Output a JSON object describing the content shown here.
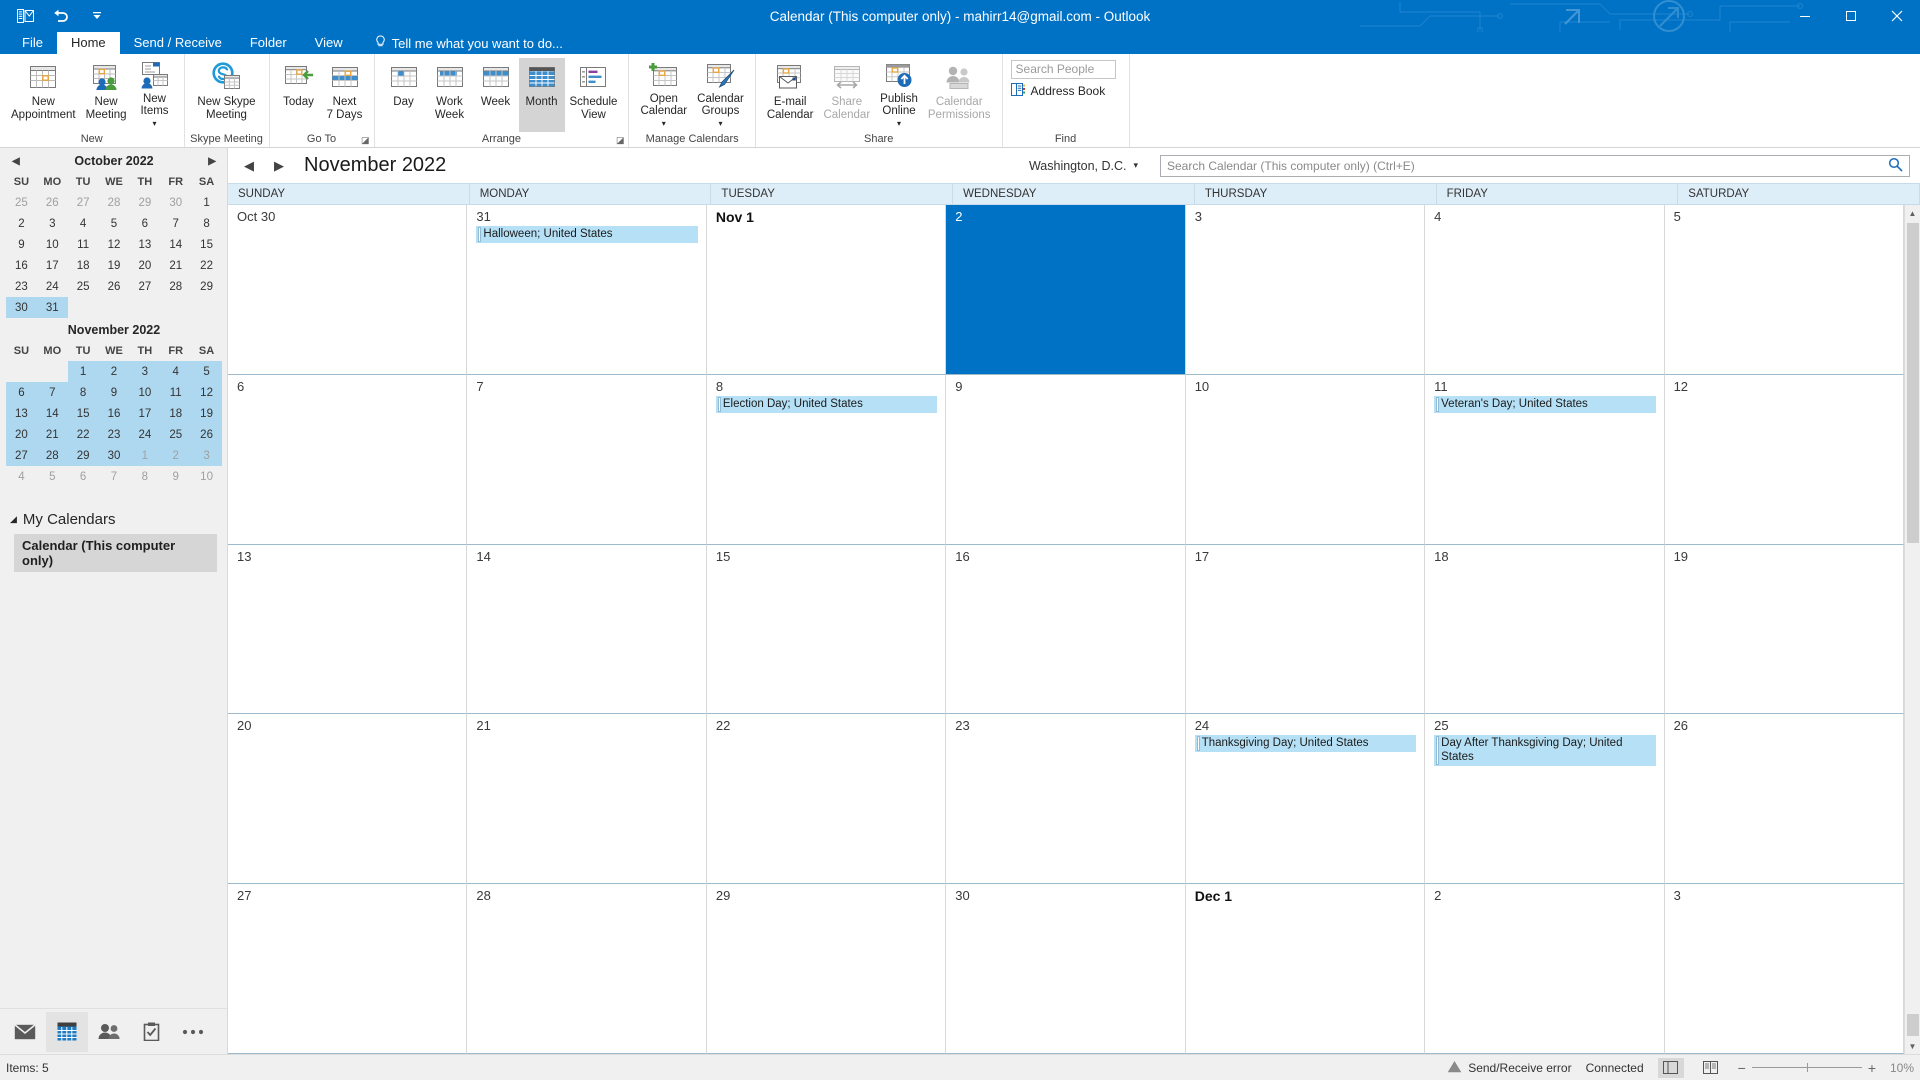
{
  "window": {
    "title": "Calendar (This computer only) - mahirr14@gmail.com - Outlook",
    "minimize": "–",
    "maximize": "□",
    "close": "✕"
  },
  "quick_access": [
    {
      "name": "send-receive-all-folders",
      "icon": "envelope-grid-icon"
    },
    {
      "name": "undo",
      "icon": "undo-arrow-icon"
    },
    {
      "name": "customize-quick-access-toolbar",
      "icon": "chevron-down-icon"
    }
  ],
  "tabs": [
    {
      "label": "File",
      "active": false
    },
    {
      "label": "Home",
      "active": true
    },
    {
      "label": "Send / Receive",
      "active": false
    },
    {
      "label": "Folder",
      "active": false
    },
    {
      "label": "View",
      "active": false
    }
  ],
  "tell_me": "Tell me what you want to do...",
  "ribbon": {
    "groups": [
      {
        "name": "New",
        "label": "New",
        "buttons": [
          {
            "label": "New\nAppointment",
            "icon": "calendar-new-icon",
            "state": "normal"
          },
          {
            "label": "New\nMeeting",
            "icon": "calendar-people-icon",
            "state": "normal",
            "dropdown": false
          },
          {
            "label": "New\nItems",
            "icon": "new-items-icon",
            "state": "normal",
            "dropdown": true
          }
        ]
      },
      {
        "name": "Skype Meeting",
        "label": "Skype Meeting",
        "buttons": [
          {
            "label": "New Skype\nMeeting",
            "icon": "skype-icon",
            "state": "normal"
          }
        ]
      },
      {
        "name": "Go To",
        "label": "Go To",
        "buttons": [
          {
            "label": "Today",
            "icon": "today-icon",
            "state": "normal"
          },
          {
            "label": "Next\n7 Days",
            "icon": "next-7-days-icon",
            "state": "normal"
          }
        ]
      },
      {
        "name": "Arrange",
        "label": "Arrange",
        "buttons": [
          {
            "label": "Day",
            "icon": "day-view-icon",
            "state": "normal"
          },
          {
            "label": "Work\nWeek",
            "icon": "work-week-icon",
            "state": "normal"
          },
          {
            "label": "Week",
            "icon": "week-view-icon",
            "state": "normal"
          },
          {
            "label": "Month",
            "icon": "month-view-icon",
            "state": "selected"
          },
          {
            "label": "Schedule\nView",
            "icon": "schedule-view-icon",
            "state": "normal"
          }
        ]
      },
      {
        "name": "Manage Calendars",
        "label": "Manage Calendars",
        "buttons": [
          {
            "label": "Open\nCalendar",
            "icon": "open-calendar-icon",
            "state": "normal",
            "dropdown": true
          },
          {
            "label": "Calendar\nGroups",
            "icon": "calendar-groups-icon",
            "state": "normal",
            "dropdown": true
          }
        ]
      },
      {
        "name": "Share",
        "label": "Share",
        "buttons": [
          {
            "label": "E-mail\nCalendar",
            "icon": "email-calendar-icon",
            "state": "normal"
          },
          {
            "label": "Share\nCalendar",
            "icon": "share-calendar-icon",
            "state": "disabled"
          },
          {
            "label": "Publish\nOnline",
            "icon": "publish-online-icon",
            "state": "normal",
            "dropdown": true
          },
          {
            "label": "Calendar\nPermissions",
            "icon": "calendar-permissions-icon",
            "state": "disabled"
          }
        ]
      }
    ],
    "find": {
      "label": "Find",
      "search_people_placeholder": "Search People",
      "address_book_label": "Address Book"
    }
  },
  "sidebar": {
    "mini_calendars": [
      {
        "title": "October 2022",
        "dow": [
          "SU",
          "MO",
          "TU",
          "WE",
          "TH",
          "FR",
          "SA"
        ],
        "weeks": [
          [
            {
              "d": "25",
              "t": "out"
            },
            {
              "d": "26",
              "t": "out"
            },
            {
              "d": "27",
              "t": "out"
            },
            {
              "d": "28",
              "t": "out"
            },
            {
              "d": "29",
              "t": "out"
            },
            {
              "d": "30",
              "t": "out"
            },
            {
              "d": "1",
              "t": "in"
            }
          ],
          [
            {
              "d": "2",
              "t": "in"
            },
            {
              "d": "3",
              "t": "in"
            },
            {
              "d": "4",
              "t": "in"
            },
            {
              "d": "5",
              "t": "in"
            },
            {
              "d": "6",
              "t": "in"
            },
            {
              "d": "7",
              "t": "in"
            },
            {
              "d": "8",
              "t": "in"
            }
          ],
          [
            {
              "d": "9",
              "t": "in"
            },
            {
              "d": "10",
              "t": "in"
            },
            {
              "d": "11",
              "t": "in"
            },
            {
              "d": "12",
              "t": "in"
            },
            {
              "d": "13",
              "t": "in"
            },
            {
              "d": "14",
              "t": "in"
            },
            {
              "d": "15",
              "t": "in"
            }
          ],
          [
            {
              "d": "16",
              "t": "in"
            },
            {
              "d": "17",
              "t": "in"
            },
            {
              "d": "18",
              "t": "in"
            },
            {
              "d": "19",
              "t": "in"
            },
            {
              "d": "20",
              "t": "in"
            },
            {
              "d": "21",
              "t": "in"
            },
            {
              "d": "22",
              "t": "in"
            }
          ],
          [
            {
              "d": "23",
              "t": "in"
            },
            {
              "d": "24",
              "t": "in"
            },
            {
              "d": "25",
              "t": "in"
            },
            {
              "d": "26",
              "t": "in"
            },
            {
              "d": "27",
              "t": "in"
            },
            {
              "d": "28",
              "t": "in"
            },
            {
              "d": "29",
              "t": "in"
            }
          ],
          [
            {
              "d": "30",
              "t": "hl"
            },
            {
              "d": "31",
              "t": "hl"
            },
            {
              "d": "",
              "t": "in"
            },
            {
              "d": "",
              "t": "in"
            },
            {
              "d": "",
              "t": "in"
            },
            {
              "d": "",
              "t": "in"
            },
            {
              "d": "",
              "t": "in"
            }
          ]
        ]
      },
      {
        "title": "November 2022",
        "dow": [
          "SU",
          "MO",
          "TU",
          "WE",
          "TH",
          "FR",
          "SA"
        ],
        "weeks": [
          [
            {
              "d": "",
              "t": "in"
            },
            {
              "d": "",
              "t": "in"
            },
            {
              "d": "1",
              "t": "hl"
            },
            {
              "d": "2",
              "t": "hl"
            },
            {
              "d": "3",
              "t": "hl"
            },
            {
              "d": "4",
              "t": "hl"
            },
            {
              "d": "5",
              "t": "hl"
            }
          ],
          [
            {
              "d": "6",
              "t": "hl"
            },
            {
              "d": "7",
              "t": "hl"
            },
            {
              "d": "8",
              "t": "hl"
            },
            {
              "d": "9",
              "t": "hl"
            },
            {
              "d": "10",
              "t": "hl"
            },
            {
              "d": "11",
              "t": "hl"
            },
            {
              "d": "12",
              "t": "hl"
            }
          ],
          [
            {
              "d": "13",
              "t": "hl"
            },
            {
              "d": "14",
              "t": "hl"
            },
            {
              "d": "15",
              "t": "hl"
            },
            {
              "d": "16",
              "t": "hl"
            },
            {
              "d": "17",
              "t": "hl"
            },
            {
              "d": "18",
              "t": "hl"
            },
            {
              "d": "19",
              "t": "hl"
            }
          ],
          [
            {
              "d": "20",
              "t": "hl"
            },
            {
              "d": "21",
              "t": "hl"
            },
            {
              "d": "22",
              "t": "hl"
            },
            {
              "d": "23",
              "t": "hl"
            },
            {
              "d": "24",
              "t": "hl"
            },
            {
              "d": "25",
              "t": "hl"
            },
            {
              "d": "26",
              "t": "hl"
            }
          ],
          [
            {
              "d": "27",
              "t": "hl"
            },
            {
              "d": "28",
              "t": "hl"
            },
            {
              "d": "29",
              "t": "hl"
            },
            {
              "d": "30",
              "t": "hl"
            },
            {
              "d": "1",
              "t": "hl-out"
            },
            {
              "d": "2",
              "t": "hl-out"
            },
            {
              "d": "3",
              "t": "hl-out"
            }
          ],
          [
            {
              "d": "4",
              "t": "out"
            },
            {
              "d": "5",
              "t": "out"
            },
            {
              "d": "6",
              "t": "out"
            },
            {
              "d": "7",
              "t": "out"
            },
            {
              "d": "8",
              "t": "out"
            },
            {
              "d": "9",
              "t": "out"
            },
            {
              "d": "10",
              "t": "out"
            }
          ]
        ]
      }
    ],
    "my_calendars_label": "My Calendars",
    "calendar_item": "Calendar (This computer only)",
    "nav_buttons": [
      {
        "name": "mail",
        "icon": "envelope-icon",
        "active": false
      },
      {
        "name": "calendar",
        "icon": "calendar-icon",
        "active": true
      },
      {
        "name": "people",
        "icon": "people-icon",
        "active": false
      },
      {
        "name": "tasks",
        "icon": "tasks-clipboard-icon",
        "active": false
      },
      {
        "name": "more",
        "icon": "ellipsis-icon",
        "active": false
      }
    ]
  },
  "calendar": {
    "prev_label": "◀",
    "next_label": "▶",
    "month_title": "November 2022",
    "weather_location": "Washington, D.C.",
    "search_placeholder": "Search Calendar (This computer only) (Ctrl+E)",
    "day_headers": [
      "SUNDAY",
      "MONDAY",
      "TUESDAY",
      "WEDNESDAY",
      "THURSDAY",
      "FRIDAY",
      "SATURDAY"
    ],
    "weeks": [
      [
        {
          "day": "Oct 30",
          "bold": false,
          "selected": false,
          "events": []
        },
        {
          "day": "31",
          "bold": false,
          "selected": false,
          "events": [
            {
              "title": "Halloween; United States",
              "arrow": "left"
            }
          ]
        },
        {
          "day": "Nov 1",
          "bold": true,
          "selected": false,
          "events": []
        },
        {
          "day": "2",
          "bold": false,
          "selected": true,
          "events": []
        },
        {
          "day": "3",
          "bold": false,
          "selected": false,
          "events": []
        },
        {
          "day": "4",
          "bold": false,
          "selected": false,
          "events": []
        },
        {
          "day": "5",
          "bold": false,
          "selected": false,
          "events": []
        }
      ],
      [
        {
          "day": "6",
          "bold": false,
          "selected": false,
          "events": []
        },
        {
          "day": "7",
          "bold": false,
          "selected": false,
          "events": []
        },
        {
          "day": "8",
          "bold": false,
          "selected": false,
          "events": [
            {
              "title": "Election Day; United States",
              "arrow": "left"
            }
          ]
        },
        {
          "day": "9",
          "bold": false,
          "selected": false,
          "events": []
        },
        {
          "day": "10",
          "bold": false,
          "selected": false,
          "events": []
        },
        {
          "day": "11",
          "bold": false,
          "selected": false,
          "events": [
            {
              "title": "Veteran's Day; United States",
              "arrow": "left"
            }
          ]
        },
        {
          "day": "12",
          "bold": false,
          "selected": false,
          "events": []
        }
      ],
      [
        {
          "day": "13",
          "bold": false,
          "selected": false,
          "events": []
        },
        {
          "day": "14",
          "bold": false,
          "selected": false,
          "events": []
        },
        {
          "day": "15",
          "bold": false,
          "selected": false,
          "events": []
        },
        {
          "day": "16",
          "bold": false,
          "selected": false,
          "events": []
        },
        {
          "day": "17",
          "bold": false,
          "selected": false,
          "events": []
        },
        {
          "day": "18",
          "bold": false,
          "selected": false,
          "events": []
        },
        {
          "day": "19",
          "bold": false,
          "selected": false,
          "events": []
        }
      ],
      [
        {
          "day": "20",
          "bold": false,
          "selected": false,
          "events": []
        },
        {
          "day": "21",
          "bold": false,
          "selected": false,
          "events": []
        },
        {
          "day": "22",
          "bold": false,
          "selected": false,
          "events": []
        },
        {
          "day": "23",
          "bold": false,
          "selected": false,
          "events": []
        },
        {
          "day": "24",
          "bold": false,
          "selected": false,
          "events": [
            {
              "title": "Thanksgiving Day; United States",
              "arrow": "left"
            }
          ]
        },
        {
          "day": "25",
          "bold": false,
          "selected": false,
          "events": [
            {
              "title": "Day After Thanksgiving Day; United States",
              "arrow": "left"
            }
          ]
        },
        {
          "day": "26",
          "bold": false,
          "selected": false,
          "events": []
        }
      ],
      [
        {
          "day": "27",
          "bold": false,
          "selected": false,
          "events": []
        },
        {
          "day": "28",
          "bold": false,
          "selected": false,
          "events": []
        },
        {
          "day": "29",
          "bold": false,
          "selected": false,
          "events": []
        },
        {
          "day": "30",
          "bold": false,
          "selected": false,
          "events": []
        },
        {
          "day": "Dec 1",
          "bold": true,
          "selected": false,
          "events": []
        },
        {
          "day": "2",
          "bold": false,
          "selected": false,
          "events": []
        },
        {
          "day": "3",
          "bold": false,
          "selected": false,
          "events": []
        }
      ]
    ]
  },
  "statusbar": {
    "items_count": "Items: 5",
    "send_receive_error": "Send/Receive error",
    "connection": "Connected",
    "zoom_level": "10%",
    "zoom_out": "−",
    "zoom_in": "+"
  },
  "colors": {
    "accent": "#0072c6",
    "event_bg": "#b5e0f5",
    "selected_day": "#0072c6",
    "minical_highlight": "#aed8f0",
    "dow_header_bg": "#deeef8",
    "arrow_red": "#e01b1b"
  }
}
